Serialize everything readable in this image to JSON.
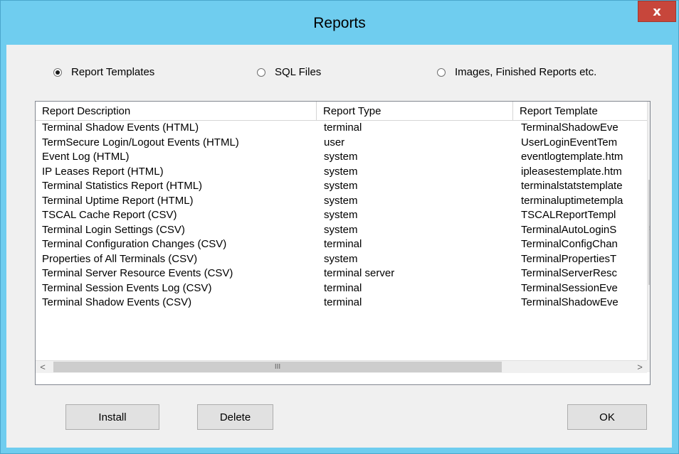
{
  "window": {
    "title": "Reports",
    "close_label": "x"
  },
  "radios": [
    {
      "label": "Report Templates",
      "checked": true
    },
    {
      "label": "SQL Files",
      "checked": false
    },
    {
      "label": "Images, Finished Reports etc.",
      "checked": false
    }
  ],
  "list": {
    "columns": [
      "Report Description",
      "Report Type",
      "Report Template"
    ],
    "rows": [
      [
        "Terminal Shadow Events (HTML)",
        "terminal",
        "TerminalShadowEve"
      ],
      [
        "TermSecure Login/Logout Events (HTML)",
        "user",
        "UserLoginEventTem"
      ],
      [
        "Event Log (HTML)",
        "system",
        "eventlogtemplate.htm"
      ],
      [
        "IP Leases Report (HTML)",
        "system",
        "ipleasestemplate.htm"
      ],
      [
        "Terminal Statistics Report (HTML)",
        "system",
        "terminalstatstemplate"
      ],
      [
        "Terminal Uptime Report (HTML)",
        "system",
        "terminaluptimetempla"
      ],
      [
        "TSCAL Cache Report (CSV)",
        "system",
        "TSCALReportTempl"
      ],
      [
        "Terminal Login Settings (CSV)",
        "system",
        "TerminalAutoLoginS"
      ],
      [
        "Terminal Configuration Changes (CSV)",
        "terminal",
        "TerminalConfigChan"
      ],
      [
        "Properties of All Terminals (CSV)",
        "system",
        "TerminalPropertiesT"
      ],
      [
        "Terminal Server Resource Events (CSV)",
        "terminal server",
        "TerminalServerResc"
      ],
      [
        "Terminal Session Events Log (CSV)",
        "terminal",
        "TerminalSessionEve"
      ],
      [
        "Terminal Shadow Events (CSV)",
        "terminal",
        "TerminalShadowEve"
      ]
    ]
  },
  "scrollbar": {
    "grip": "≡",
    "hgrip": "III",
    "up": "^",
    "down": "v",
    "left": "<",
    "right": ">"
  },
  "buttons": {
    "install": "Install",
    "delete": "Delete",
    "ok": "OK"
  }
}
